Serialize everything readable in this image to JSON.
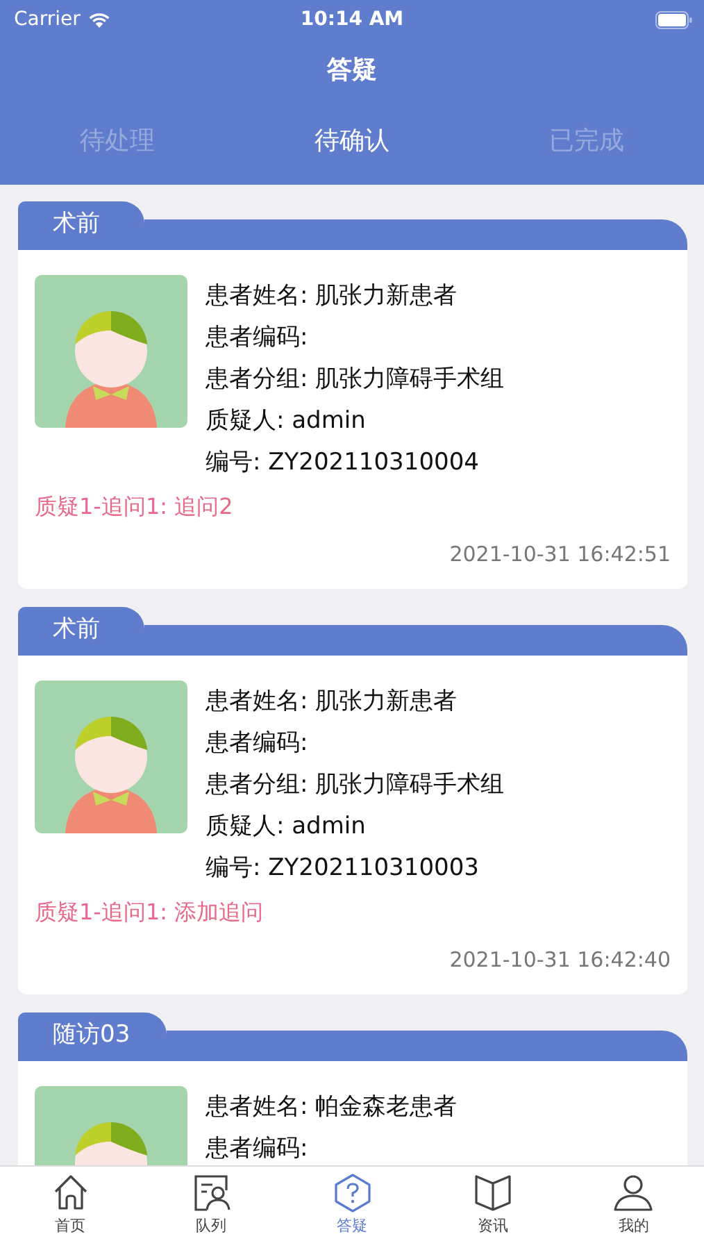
{
  "status_bar": {
    "carrier": "Carrier",
    "time": "10:14 AM"
  },
  "nav": {
    "title": "答疑"
  },
  "tabs": [
    {
      "label": "待处理",
      "selected": false
    },
    {
      "label": "待确认",
      "selected": true
    },
    {
      "label": "已完成",
      "selected": false
    }
  ],
  "cards": [
    {
      "tag": "术前",
      "lines": [
        "患者姓名: 肌张力新患者",
        "患者编码:",
        "患者分组: 肌张力障碍手术组",
        "质疑人: admin",
        "编号: ZY202110310004"
      ],
      "query": "质疑1-追问1: 追问2",
      "time": "2021-10-31 16:42:51"
    },
    {
      "tag": "术前",
      "lines": [
        "患者姓名: 肌张力新患者",
        "患者编码:",
        "患者分组: 肌张力障碍手术组",
        "质疑人: admin",
        "编号: ZY202110310003"
      ],
      "query": "质疑1-追问1: 添加追问",
      "time": "2021-10-31 16:42:40"
    },
    {
      "tag": "随访03",
      "lines": [
        "患者姓名: 帕金森老患者",
        "患者编码:"
      ]
    }
  ],
  "tab_bar": [
    {
      "label": "首页",
      "kind": "home",
      "selected": false
    },
    {
      "label": "队列",
      "kind": "queue",
      "selected": false
    },
    {
      "label": "答疑",
      "kind": "question",
      "selected": true
    },
    {
      "label": "资讯",
      "kind": "book",
      "selected": false
    },
    {
      "label": "我的",
      "kind": "profile",
      "selected": false
    }
  ]
}
